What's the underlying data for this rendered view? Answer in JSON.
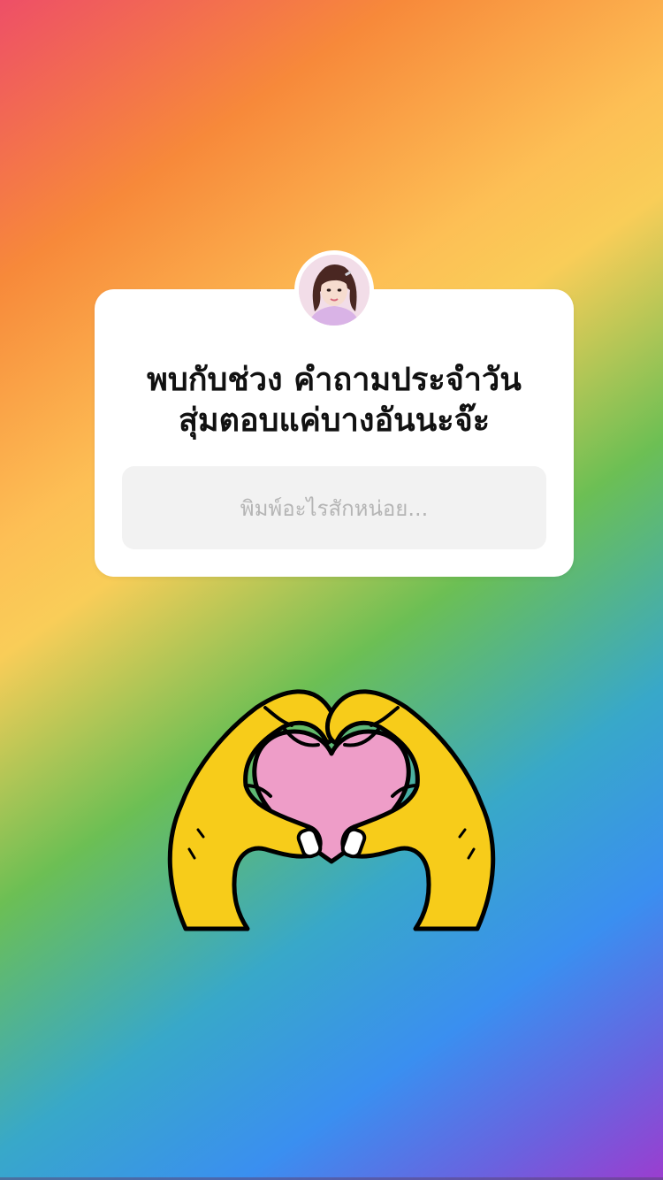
{
  "question_sticker": {
    "question_lines": [
      "พบกับช่วง คำถามประจำวัน",
      "สุ่มตอบแค่บางอันนะจ๊ะ"
    ],
    "answer_placeholder": "พิมพ์อะไรสักหน่อย..."
  },
  "background": {
    "gradient_colors": [
      "#ee4f67",
      "#f7893a",
      "#fdbf55",
      "#6cbf54",
      "#3a8ff0",
      "#9b3dcf"
    ]
  },
  "sticker": {
    "icon": "heart-hands-icon",
    "colors": {
      "hands": "#f7cc1a",
      "heart": "#ee9dc8",
      "outline": "#000000"
    }
  },
  "avatar": {
    "icon": "avatar"
  }
}
